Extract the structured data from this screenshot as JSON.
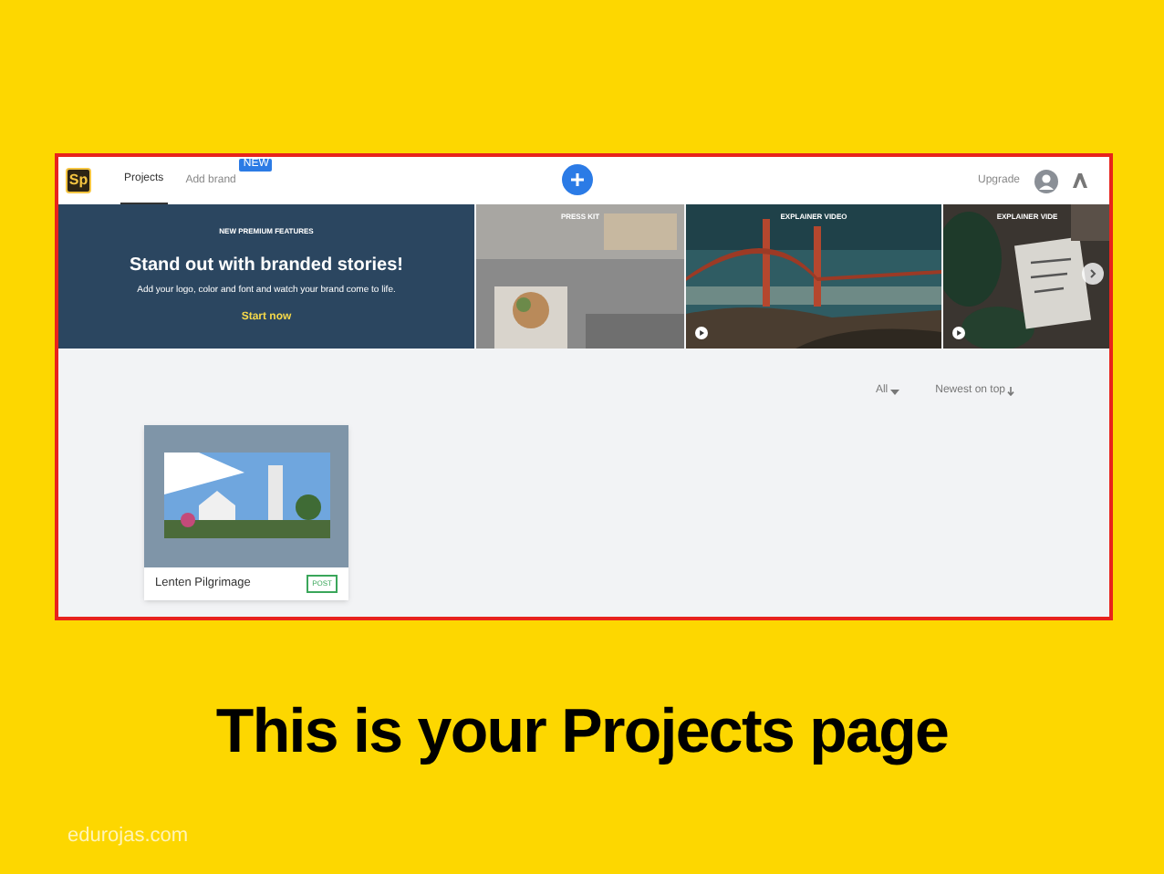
{
  "slide": {
    "title": "This is your Projects page",
    "footer": "edurojas.com"
  },
  "app": {
    "logo": "Sp",
    "tabs": [
      {
        "label": "Projects",
        "selected": true
      },
      {
        "label": "Add brand",
        "selected": false,
        "badge": "NEW"
      }
    ],
    "upgrade": "Upgrade",
    "promo": {
      "eyebrow": "NEW PREMIUM FEATURES",
      "headline": "Stand out with branded stories!",
      "body": "Add your logo, color and font and watch your brand come to life.",
      "cta": "Start now"
    },
    "showcase": [
      {
        "label": "PRESS KIT"
      },
      {
        "label": "EXPLAINER VIDEO",
        "kind": "video"
      },
      {
        "label": "EXPLAINER VIDE",
        "kind": "video"
      }
    ],
    "filter": "All",
    "sort": "Newest on top",
    "projects": [
      {
        "title": "Lenten Pilgrimage",
        "type": "POST"
      }
    ]
  }
}
